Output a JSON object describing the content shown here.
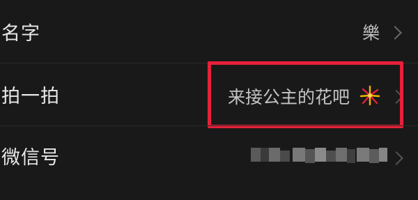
{
  "profile": {
    "name_label": "名字",
    "name_value": "樂",
    "pat_label": "拍一拍",
    "pat_value": "来接公主的花吧",
    "pat_emoji": "firework-emoji",
    "wechat_id_label": "微信号",
    "wechat_id_value_state": "pixelated"
  },
  "colors": {
    "background": "#191919",
    "highlight_border": "#e8203a",
    "label_text": "#e8e8e8",
    "value_text": "#a8a8a8"
  }
}
